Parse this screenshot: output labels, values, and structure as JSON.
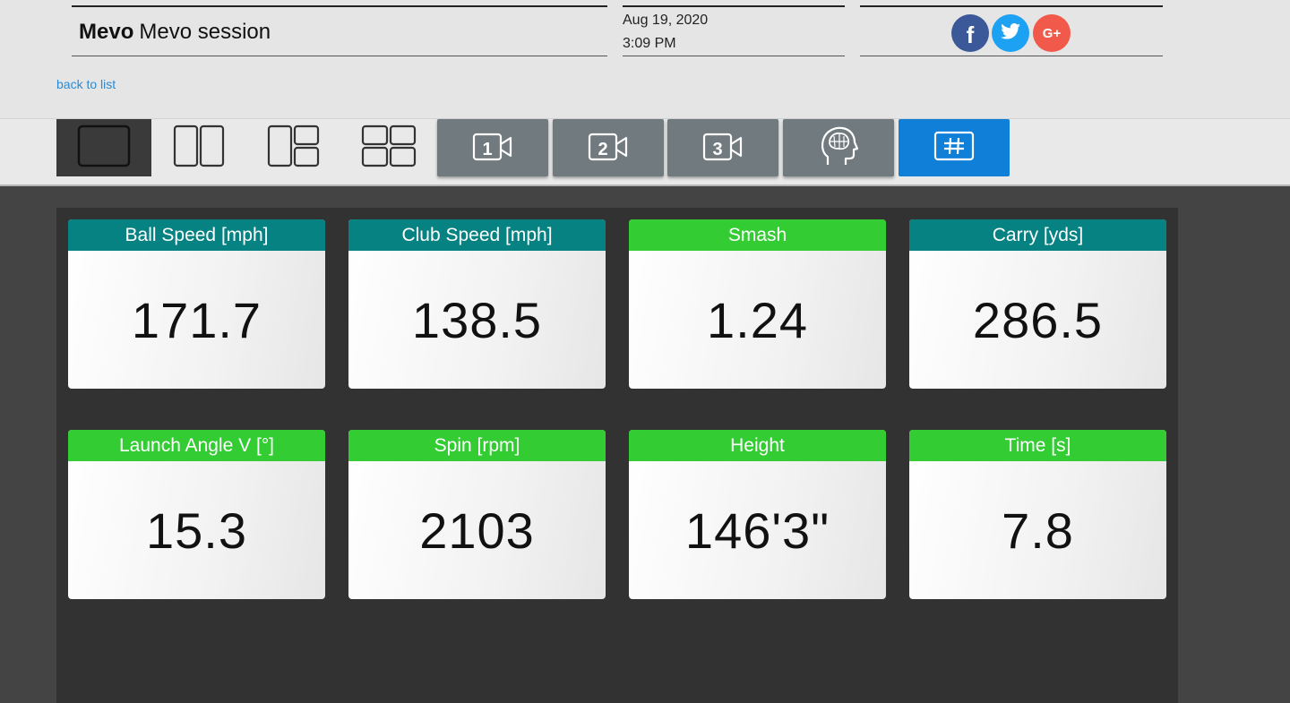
{
  "header": {
    "brand": "Mevo",
    "session_title": "Mevo session",
    "date": "Aug 19, 2020",
    "time": "3:09 PM",
    "back_link": "back to list",
    "social": [
      {
        "name": "facebook",
        "icon": "facebook-icon",
        "glyph": "f",
        "color": "#3b5998"
      },
      {
        "name": "twitter",
        "icon": "twitter-icon",
        "glyph": "",
        "color": "#1da1f2"
      },
      {
        "name": "google-plus",
        "icon": "google-plus-icon",
        "glyph": "G+",
        "color": "#f15a4a"
      }
    ]
  },
  "toolbar": {
    "layouts": [
      {
        "icon": "single-pane-layout-icon",
        "active": true
      },
      {
        "icon": "two-pane-layout-icon",
        "active": false
      },
      {
        "icon": "three-pane-layout-icon",
        "active": false
      },
      {
        "icon": "four-pane-layout-icon",
        "active": false
      }
    ],
    "views": [
      {
        "icon": "camera-1-icon",
        "number": "1",
        "active": false
      },
      {
        "icon": "camera-2-icon",
        "number": "2",
        "active": false
      },
      {
        "icon": "camera-3-icon",
        "number": "3",
        "active": false
      },
      {
        "icon": "brain-head-icon",
        "active": false
      },
      {
        "icon": "grid-hash-icon",
        "active": true
      }
    ],
    "colors": {
      "view_button": "#717a7e",
      "active_view": "#0f7fd8"
    }
  },
  "metrics": [
    {
      "label": "Ball Speed [mph]",
      "value": "171.7",
      "header_color": "teal"
    },
    {
      "label": "Club Speed [mph]",
      "value": "138.5",
      "header_color": "teal"
    },
    {
      "label": "Smash",
      "value": "1.24",
      "header_color": "green"
    },
    {
      "label": "Carry [yds]",
      "value": "286.5",
      "header_color": "teal"
    },
    {
      "label": "Launch Angle V [°]",
      "value": "15.3",
      "header_color": "green"
    },
    {
      "label": "Spin [rpm]",
      "value": "2103",
      "header_color": "green"
    },
    {
      "label": "Height",
      "value": "146'3\"",
      "header_color": "green"
    },
    {
      "label": "Time [s]",
      "value": "7.8",
      "header_color": "green"
    }
  ],
  "colors": {
    "teal": "#078282",
    "green": "#33cc33",
    "panel": "#323232"
  }
}
